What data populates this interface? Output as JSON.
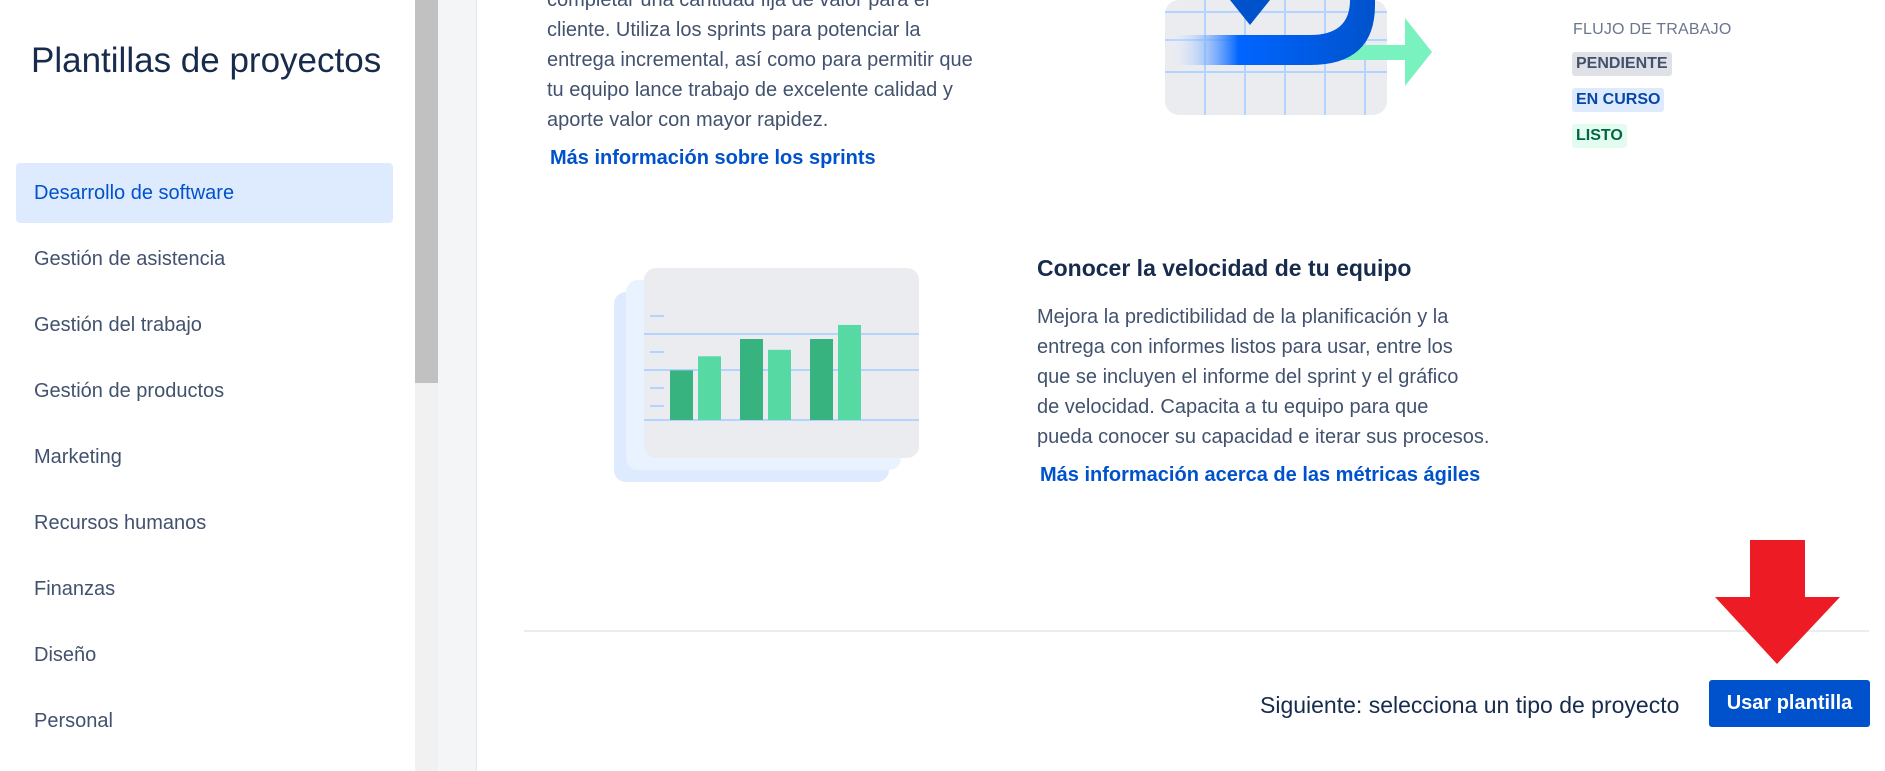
{
  "sidebar": {
    "title": "Plantillas de proyectos",
    "items": [
      {
        "label": "Desarrollo de software",
        "selected": true
      },
      {
        "label": "Gestión de asistencia"
      },
      {
        "label": "Gestión del trabajo"
      },
      {
        "label": "Gestión de productos"
      },
      {
        "label": "Marketing"
      },
      {
        "label": "Recursos humanos"
      },
      {
        "label": "Finanzas"
      },
      {
        "label": "Diseño"
      },
      {
        "label": "Personal"
      }
    ]
  },
  "sprints_section": {
    "paragraph": "completar una cantidad fija de valor para el\ncliente. Utiliza los sprints para potenciar la\nentrega incremental, así como para permitir que\ntu equipo lance trabajo de excelente calidad y\naporte valor con mayor rapidez.",
    "link": "Más información sobre los sprints"
  },
  "workflow": {
    "label": "FLUJO DE TRABAJO",
    "statuses": [
      {
        "label": "PENDIENTE",
        "color": "#42526e",
        "bg": "#dfe1e6"
      },
      {
        "label": "EN CURSO",
        "color": "#0747a6",
        "bg": "#deebff"
      },
      {
        "label": "LISTO",
        "color": "#006644",
        "bg": "#e3fcef"
      }
    ]
  },
  "velocity_section": {
    "heading": "Conocer la velocidad de tu equipo",
    "paragraph": "Mejora la predictibilidad de la planificación y la\nentrega con informes listos para usar, entre los\nque se incluyen el informe del sprint y el gráfico\nde velocidad. Capacita a tu equipo para que\npueda conocer su capacidad e iterar sus procesos.",
    "link": "Más información acerca de las métricas ágiles"
  },
  "footer": {
    "next_text": "Siguiente: selecciona un tipo de proyecto",
    "button_label": "Usar plantilla"
  },
  "colors": {
    "accent": "#0052cc",
    "selected_bg": "#deebff",
    "annotation_arrow": "#ed1c24"
  },
  "icons": {
    "sprint_illustration": "sprint-cycle-illustration",
    "velocity_illustration": "velocity-bar-chart-illustration",
    "annotation": "red-down-arrow-icon"
  },
  "chart_data": {
    "type": "bar",
    "categories": [
      "",
      "",
      "",
      "",
      "",
      ""
    ],
    "values": [
      46,
      59,
      75,
      65,
      75,
      88
    ],
    "ylim": [
      0,
      100
    ]
  }
}
